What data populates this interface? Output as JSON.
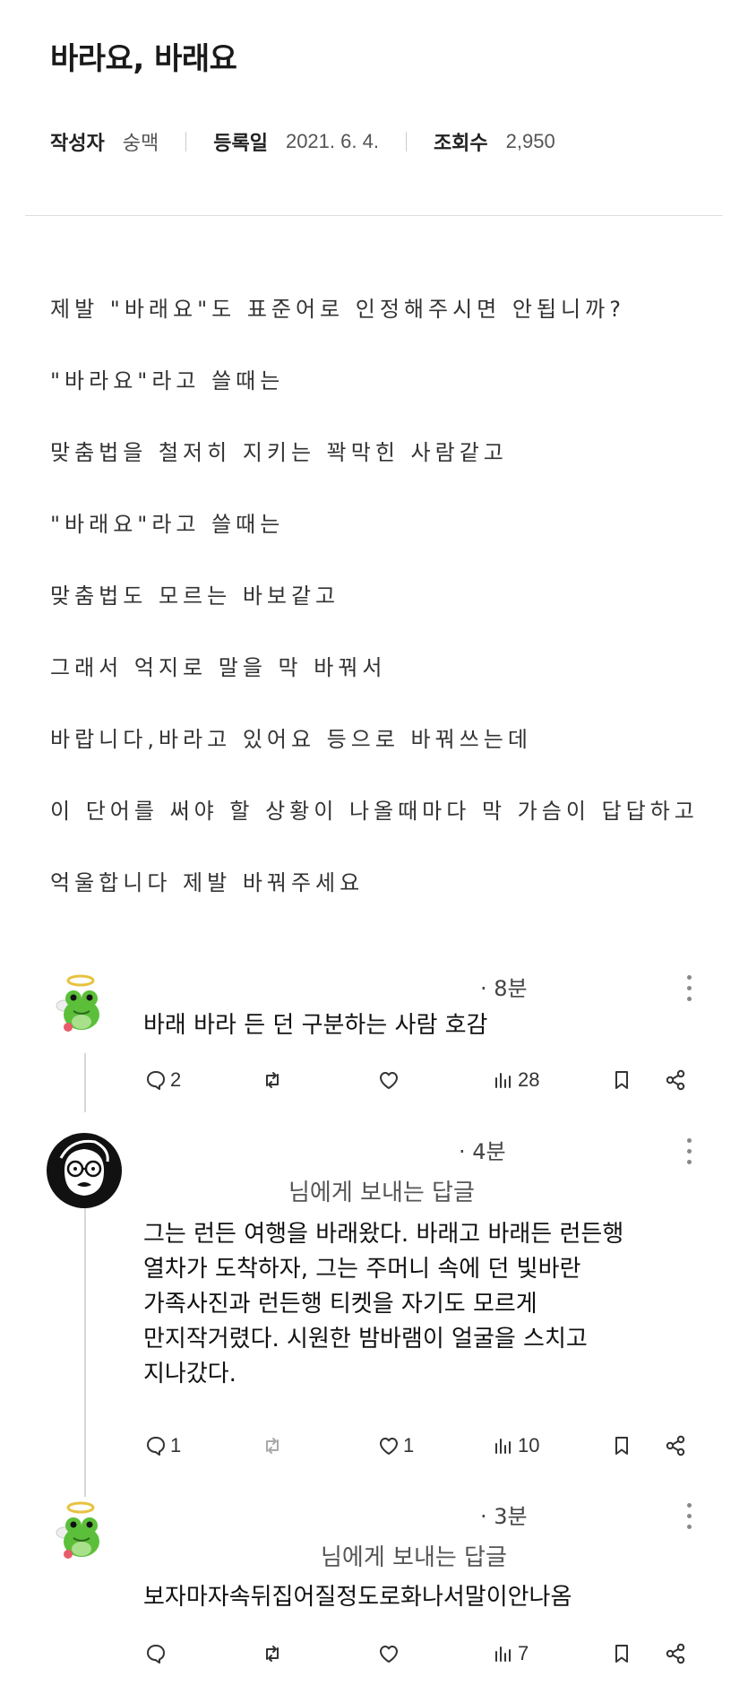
{
  "post": {
    "title": "바라요, 바래요",
    "meta": {
      "author_label": "작성자",
      "author": "숭맥",
      "date_label": "등록일",
      "date": "2021. 6. 4.",
      "views_label": "조회수",
      "views": "2,950"
    },
    "body_lines": [
      "제발 \"바래요\"도 표준어로 인정해주시면 안됩니까?",
      "\"바라요\"라고 쓸때는",
      "맞춤법을 철저히 지키는 꽉막힌 사람같고",
      "\"바래요\"라고 쓸때는",
      "맞춤법도 모르는 바보같고",
      "그래서 억지로 말을 막 바꿔서",
      "바랍니다,바라고 있어요 등으로 바꿔쓰는데",
      "이 단어를 써야 할 상황이 나올때마다 막 가슴이 답답하고",
      "억울합니다 제발 바꿔주세요"
    ]
  },
  "comments": [
    {
      "time": "· 8분",
      "reply_to": "",
      "text_lines": [
        "바래 바라 든 던 구분하는 사람 호감"
      ],
      "replies": "2",
      "likes": "",
      "views": "28"
    },
    {
      "time": "· 4분",
      "reply_to": "님에게 보내는 답글",
      "text_lines": [
        "그는 런든 여행을 바래왔다. 바래고 바래든 런든행",
        "열차가 도착하자, 그는 주머니 속에 던 빛바란",
        "가족사진과 런든행 티켓을 자기도 모르게",
        "만지작거렸다. 시원한 밤바램이 얼굴을 스치고",
        "지나갔다."
      ],
      "replies": "1",
      "likes": "1",
      "views": "10"
    },
    {
      "time": "· 3분",
      "reply_to": "님에게 보내는 답글",
      "text_lines": [
        "보자마자속뒤집어질정도로화나서말이안나옴"
      ],
      "replies": "",
      "likes": "",
      "views": "7"
    }
  ],
  "icons": {
    "reply": "speech-bubble-icon",
    "retweet": "retweet-icon",
    "like": "heart-icon",
    "views": "bar-chart-icon",
    "bookmark": "bookmark-icon",
    "share": "share-icon",
    "more": "more-vertical-icon"
  },
  "colors": {
    "frog": "#5cbf3a",
    "halo": "#e8c240",
    "thread_line": "#d7d7d7"
  }
}
